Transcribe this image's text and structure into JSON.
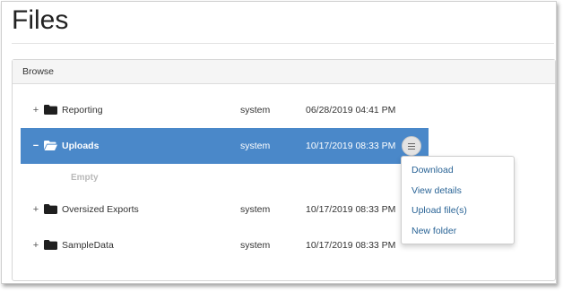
{
  "page": {
    "title": "Files"
  },
  "panel": {
    "heading": "Browse"
  },
  "tree": {
    "rows": [
      {
        "toggle": "+",
        "name": "Reporting",
        "owner": "system",
        "modified": "06/28/2019 04:41 PM"
      },
      {
        "toggle": "−",
        "name": "Uploads",
        "owner": "system",
        "modified": "10/17/2019 08:33 PM",
        "selected": true
      },
      {
        "empty_label": "Empty"
      },
      {
        "toggle": "+",
        "name": "Oversized Exports",
        "owner": "system",
        "modified": "10/17/2019 08:33 PM"
      },
      {
        "toggle": "+",
        "name": "SampleData",
        "owner": "system",
        "modified": "10/17/2019 08:33 PM"
      }
    ]
  },
  "context_menu": {
    "items": [
      {
        "label": "Download"
      },
      {
        "label": "View details"
      },
      {
        "label": "Upload file(s)"
      },
      {
        "label": "New folder"
      }
    ]
  },
  "colors": {
    "selected_row": "#4a88c9",
    "link": "#2a6496",
    "folder_closed": "#1f1f1f",
    "folder_open": "#ffffff"
  },
  "icons": {
    "folder": "folder-icon",
    "folder_open": "folder-open-icon",
    "menu": "hamburger-menu-icon"
  }
}
